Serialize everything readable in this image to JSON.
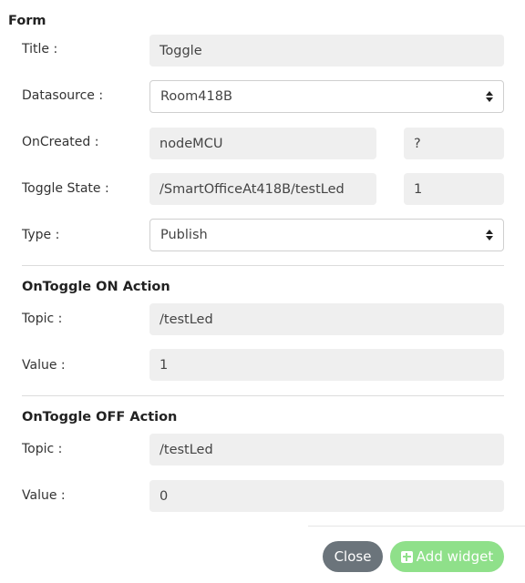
{
  "form": {
    "heading": "Form",
    "title_label": "Title :",
    "title_value": "Toggle",
    "datasource_label": "Datasource :",
    "datasource_value": "Room418B",
    "oncreated_label": "OnCreated :",
    "oncreated_value": "nodeMCU",
    "oncreated_extra": "?",
    "toggle_state_label": "Toggle State :",
    "toggle_state_value": "/SmartOfficeAt418B/testLed",
    "toggle_state_extra": "1",
    "type_label": "Type :",
    "type_value": "Publish"
  },
  "on_action": {
    "heading": "OnToggle ON Action",
    "topic_label": "Topic :",
    "topic_value": "/testLed",
    "value_label": "Value :",
    "value_value": "1"
  },
  "off_action": {
    "heading": "OnToggle OFF Action",
    "topic_label": "Topic :",
    "topic_value": "/testLed",
    "value_label": "Value :",
    "value_value": "0"
  },
  "footer": {
    "close_label": "Close",
    "add_label": "Add widget"
  },
  "colors": {
    "field_bg": "#efefef",
    "close_btn": "#6b747b",
    "add_btn": "#8fe08a"
  }
}
